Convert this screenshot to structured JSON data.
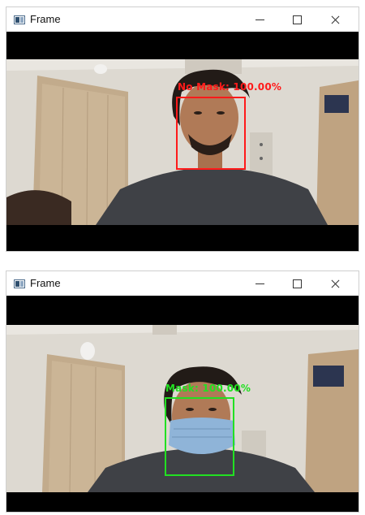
{
  "windows": [
    {
      "title": "Frame",
      "detection": {
        "label": "No Mask: 100.00%",
        "color": "#ff1a1a",
        "mask_worn": false
      }
    },
    {
      "title": "Frame",
      "detection": {
        "label": "Mask: 100.00%",
        "color": "#22e022",
        "mask_worn": true
      }
    }
  ],
  "window_controls": [
    "minimize-icon",
    "maximize-icon",
    "close-icon"
  ],
  "colors": {
    "wall": "#ddd9d1",
    "door": "#c2ab8c",
    "shirt": "#3f4146",
    "hair": "#221b17",
    "skin": "#b07a57",
    "mask": "#8fb4d8"
  }
}
